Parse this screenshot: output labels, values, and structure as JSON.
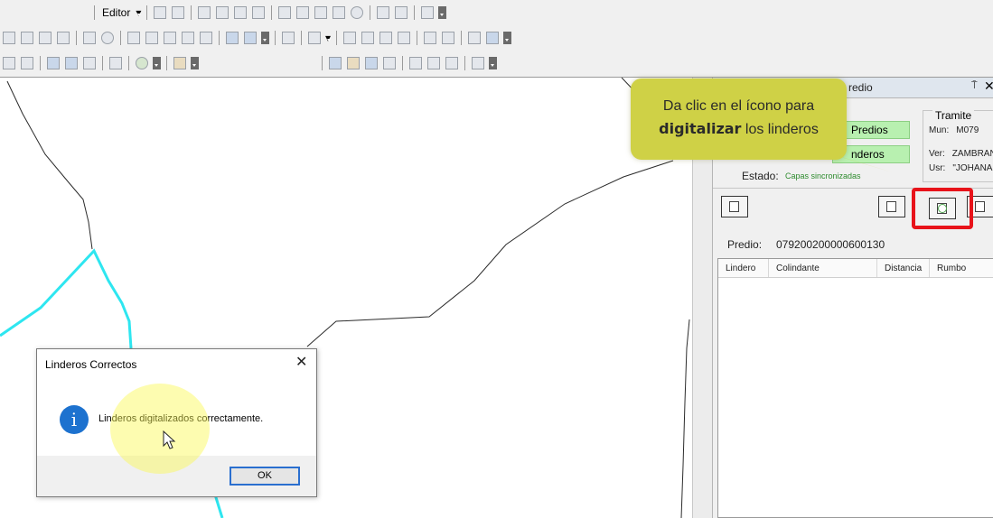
{
  "toolbar": {
    "editor_label": "Editor"
  },
  "panel": {
    "title": "redio",
    "pin_glyph": "⍑",
    "close_glyph": "✕",
    "layer_predios": "Predios",
    "layer_linderos": "nderos",
    "estado_label": "Estado:",
    "estado_value": "Capas sincronizadas",
    "tramite": {
      "header": "Tramite",
      "mun_label": "Mun:",
      "mun_value": "M079",
      "ver_label": "Ver:",
      "ver_value": "ZAMBRAN",
      "usr_label": "Usr:",
      "usr_value": "\"JOHANA"
    },
    "predio_label": "Predio:",
    "predio_value": "079200200000600130",
    "grid_columns": [
      "Lindero",
      "Colindante",
      "Distancia",
      "Rumbo"
    ]
  },
  "callout": {
    "line1": "Da clic en el ícono para",
    "line2_bold": "digitalizar",
    "line2_rest": " los linderos"
  },
  "dialog": {
    "title": "Linderos Correctos",
    "close_glyph": "✕",
    "info_glyph": "i",
    "message": "Linderos digitalizados correctamente.",
    "ok_label": "OK"
  },
  "colors": {
    "callout": "#cfd146",
    "highlight": "#e8131a",
    "parcel_line": "#2ee6f0",
    "boundary_line": "#2b2b2b",
    "layer_button": "#b8f0b0"
  }
}
